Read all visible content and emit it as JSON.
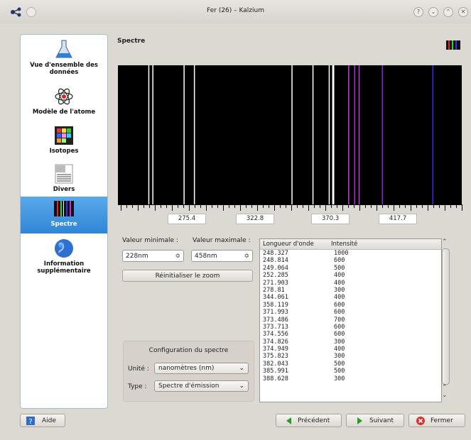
{
  "window": {
    "title": "Fer (26) – Kalzium",
    "help_glyph": "?",
    "minimize_glyph": "⌄",
    "maximize_glyph": "⌃",
    "close_glyph": "✕"
  },
  "sidebar": {
    "items": [
      {
        "label": "Vue d'ensemble des données",
        "icon": "flask-icon"
      },
      {
        "label": "Modèle de l'atome",
        "icon": "atom-icon"
      },
      {
        "label": "Isotopes",
        "icon": "isotopes-icon"
      },
      {
        "label": "Divers",
        "icon": "misc-icon"
      },
      {
        "label": "Spectre",
        "icon": "spectrum-icon",
        "active": true
      },
      {
        "label": "Information supplémentaire",
        "icon": "globe-icon"
      }
    ]
  },
  "main": {
    "title": "Spectre",
    "ruler_labels": [
      "275.4",
      "322.8",
      "370.3",
      "417.7"
    ],
    "min_label": "Valeur minimale :",
    "max_label": "Valeur maximale :",
    "min_value": "228nm",
    "max_value": "458nm",
    "reset_zoom": "Réinitialiser le zoom",
    "config_title": "Configuration du spectre",
    "unit_label": "Unité :",
    "unit_value": "nanomètres (nm)",
    "type_label": "Type :",
    "type_value": "Spectre d'émission"
  },
  "table": {
    "col1": "Longueur d'onde",
    "col2": "Intensité",
    "rows": [
      [
        "248.327",
        "1000"
      ],
      [
        "248.814",
        "600"
      ],
      [
        "249.064",
        "500"
      ],
      [
        "252.285",
        "400"
      ],
      [
        "271.903",
        "400"
      ],
      [
        "278.81",
        "300"
      ],
      [
        "344.061",
        "400"
      ],
      [
        "358.119",
        "600"
      ],
      [
        "371.993",
        "600"
      ],
      [
        "373.486",
        "700"
      ],
      [
        "373.713",
        "600"
      ],
      [
        "374.556",
        "600"
      ],
      [
        "374.826",
        "300"
      ],
      [
        "374.949",
        "400"
      ],
      [
        "375.823",
        "300"
      ],
      [
        "382.043",
        "500"
      ],
      [
        "385.991",
        "500"
      ],
      [
        "388.628",
        "300"
      ]
    ]
  },
  "buttons": {
    "help": "Aide",
    "previous": "Précédent",
    "next": "Suivant",
    "close": "Fermer"
  },
  "spectrum": {
    "min_nm": 228,
    "max_nm": 458,
    "lines": [
      {
        "nm": 248.3,
        "color": "#ffffff"
      },
      {
        "nm": 251.0,
        "color": "#ffffff"
      },
      {
        "nm": 271.9,
        "color": "#ffffff"
      },
      {
        "nm": 278.8,
        "color": "#ffffff"
      },
      {
        "nm": 344.1,
        "color": "#ffffff"
      },
      {
        "nm": 358.1,
        "color": "#ffffff"
      },
      {
        "nm": 369.0,
        "color": "#ffffff"
      },
      {
        "nm": 371.3,
        "color": "#ffffff"
      },
      {
        "nm": 372.0,
        "color": "#ffffff"
      },
      {
        "nm": 382.0,
        "color": "#c03cd8"
      },
      {
        "nm": 386.0,
        "color": "#a030d0"
      },
      {
        "nm": 389.0,
        "color": "#c03cd8"
      },
      {
        "nm": 404.6,
        "color": "#8a2ad0"
      },
      {
        "nm": 438.3,
        "color": "#3a2ad8"
      }
    ]
  }
}
